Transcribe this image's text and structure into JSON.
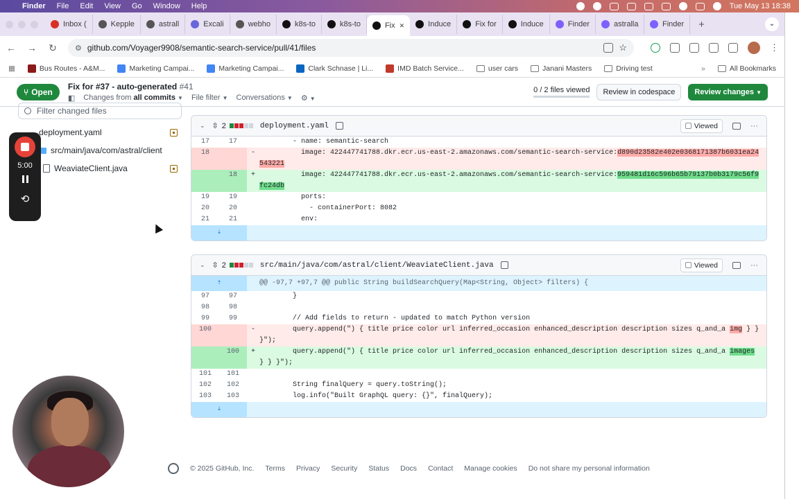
{
  "menubar": {
    "app": "Finder",
    "menus": [
      "File",
      "Edit",
      "View",
      "Go",
      "Window",
      "Help"
    ],
    "datetime": "Tue May 13  18:38"
  },
  "tabs": [
    {
      "label": "Inbox (",
      "color": "#d93025"
    },
    {
      "label": "Kepple",
      "color": "#555"
    },
    {
      "label": "astrall",
      "color": "#555"
    },
    {
      "label": "Excali",
      "color": "#6965db"
    },
    {
      "label": "webho",
      "color": "#555"
    },
    {
      "label": "k8s-to",
      "color": "#111"
    },
    {
      "label": "k8s-to",
      "color": "#111"
    },
    {
      "label": "Fix",
      "color": "#111",
      "active": true
    },
    {
      "label": "Induce",
      "color": "#111"
    },
    {
      "label": "Fix for",
      "color": "#111"
    },
    {
      "label": "Induce",
      "color": "#111"
    },
    {
      "label": "Finder",
      "color": "#7b61ff"
    },
    {
      "label": "astralla",
      "color": "#7b61ff"
    },
    {
      "label": "Finder",
      "color": "#7b61ff"
    }
  ],
  "address": {
    "url": "github.com/Voyager9908/semantic-search-service/pull/41/files"
  },
  "bookmarks": [
    {
      "label": "Bus Routes - A&M...",
      "color": "#8b1a1a"
    },
    {
      "label": "Marketing Campai...",
      "color": "#4285f4"
    },
    {
      "label": "Marketing Campai...",
      "color": "#4285f4"
    },
    {
      "label": "Clark Schnase | Li...",
      "color": "#0a66c2"
    },
    {
      "label": "IMD Batch Service...",
      "color": "#c0392b"
    },
    {
      "label": "user cars",
      "color": ""
    },
    {
      "label": "Janani Masters",
      "color": ""
    },
    {
      "label": "Driving test",
      "color": ""
    }
  ],
  "bookmarks_all": "All Bookmarks",
  "pr": {
    "state": "Open",
    "title": "Fix for #37 - auto-generated",
    "number": "#41",
    "changes_from": "Changes from",
    "all_commits": "all commits",
    "file_filter": "File filter",
    "conversations": "Conversations",
    "viewed_count": "0 / 2 files viewed",
    "review_codespace": "Review in codespace",
    "review_changes": "Review changes"
  },
  "sidebar": {
    "filter_placeholder": "Filter changed files",
    "files": [
      {
        "label": "deployment.yaml"
      },
      {
        "label": "src/main/java/com/astral/client"
      },
      {
        "label": "WeaviateClient.java"
      }
    ]
  },
  "recorder": {
    "time": "5:00"
  },
  "diff1": {
    "count": "2",
    "file": "deployment.yaml",
    "viewed": "Viewed",
    "lines": [
      {
        "type": "ctx",
        "old": "17",
        "new": "17",
        "sign": "",
        "code": "        - name: semantic-search"
      },
      {
        "type": "del",
        "old": "18",
        "new": "",
        "sign": "-",
        "pre": "          image: 422447741788.dkr.ecr.us-east-2.amazonaws.com/semantic-search-service:",
        "hl": "d890d23582e402e0368171387b6031ea24543221",
        "post": ""
      },
      {
        "type": "add",
        "old": "",
        "new": "18",
        "sign": "+",
        "pre": "          image: 422447741788.dkr.ecr.us-east-2.amazonaws.com/semantic-search-service:",
        "hl": "959481d16c596b65b79137b0b3179c56f9fc24db",
        "post": ""
      },
      {
        "type": "ctx",
        "old": "19",
        "new": "19",
        "sign": "",
        "code": "          ports:"
      },
      {
        "type": "ctx",
        "old": "20",
        "new": "20",
        "sign": "",
        "code": "            - containerPort: 8082"
      },
      {
        "type": "ctx",
        "old": "21",
        "new": "21",
        "sign": "",
        "code": "          env:"
      }
    ]
  },
  "diff2": {
    "count": "2",
    "file": "src/main/java/com/astral/client/WeaviateClient.java",
    "viewed": "Viewed",
    "hunk": "@@ -97,7 +97,7 @@ public String buildSearchQuery(Map<String, Object> filters) {",
    "lines": [
      {
        "type": "ctx",
        "old": "97",
        "new": "97",
        "sign": "",
        "code": "        }"
      },
      {
        "type": "ctx",
        "old": "98",
        "new": "98",
        "sign": "",
        "code": ""
      },
      {
        "type": "ctx",
        "old": "99",
        "new": "99",
        "sign": "",
        "code": "        // Add fields to return - updated to match Python version"
      },
      {
        "type": "del",
        "old": "100",
        "new": "",
        "sign": "-",
        "pre": "        query.append(\") { title price color url inferred_occasion enhanced_description description sizes q_and_a ",
        "hl": "img",
        "post": " } } }\");"
      },
      {
        "type": "add",
        "old": "",
        "new": "100",
        "sign": "+",
        "pre": "        query.append(\") { title price color url inferred_occasion enhanced_description description sizes q_and_a ",
        "hl": "images",
        "post": " } } }\");"
      },
      {
        "type": "ctx",
        "old": "101",
        "new": "101",
        "sign": "",
        "code": ""
      },
      {
        "type": "ctx",
        "old": "102",
        "new": "102",
        "sign": "",
        "code": "        String finalQuery = query.toString();"
      },
      {
        "type": "ctx",
        "old": "103",
        "new": "103",
        "sign": "",
        "code": "        log.info(\"Built GraphQL query: {}\", finalQuery);"
      }
    ]
  },
  "footer": {
    "copyright": "© 2025 GitHub, Inc.",
    "links": [
      "Terms",
      "Privacy",
      "Security",
      "Status",
      "Docs",
      "Contact",
      "Manage cookies",
      "Do not share my personal information"
    ]
  }
}
